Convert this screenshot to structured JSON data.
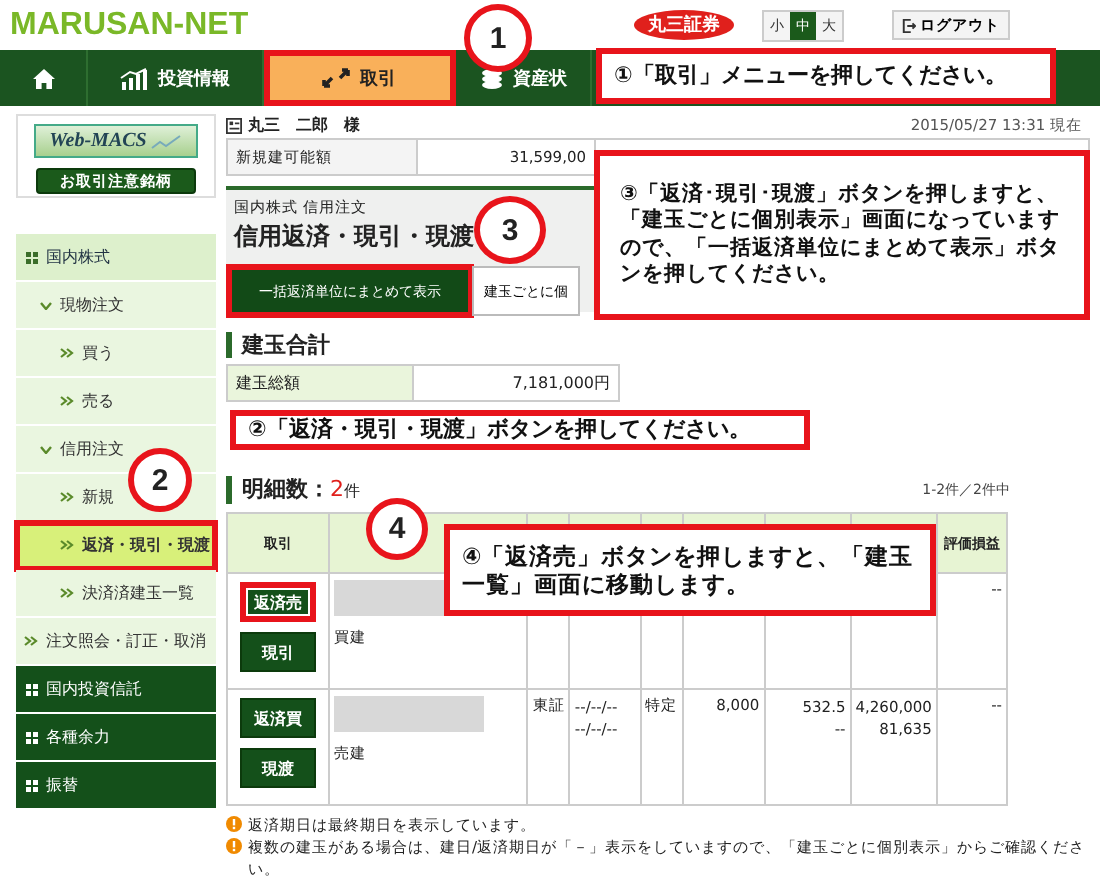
{
  "header": {
    "logo": "MARUSAN-NET",
    "brand_badge": "丸三証券",
    "font_sizes": [
      {
        "label": "小",
        "selected": false
      },
      {
        "label": "中",
        "selected": true
      },
      {
        "label": "大",
        "selected": false
      }
    ],
    "logout": "ログアウト"
  },
  "nav": [
    {
      "kind": "home",
      "selected": false
    },
    {
      "kind": "chart",
      "label": "投資情報",
      "selected": false
    },
    {
      "kind": "trade",
      "label": "取引",
      "selected": true
    },
    {
      "kind": "coins",
      "label": "資産状",
      "selected": false
    }
  ],
  "sidebar": {
    "logo": "Web-MACS",
    "notice_button": "お取引注意銘柄",
    "menu": [
      {
        "kind": "section",
        "label": "国内株式",
        "expanded": true,
        "children": [
          {
            "kind": "group",
            "label": "現物注文",
            "expanded": true,
            "children": [
              {
                "kind": "link",
                "label": "買う",
                "selected": false
              },
              {
                "kind": "link",
                "label": "売る",
                "selected": false
              }
            ]
          },
          {
            "kind": "group",
            "label": "信用注文",
            "expanded": true,
            "children": [
              {
                "kind": "link",
                "label": "新規",
                "selected": false
              },
              {
                "kind": "link",
                "label": "返済・現引・現渡",
                "selected": true
              },
              {
                "kind": "link",
                "label": "決済済建玉一覧",
                "selected": false
              }
            ]
          },
          {
            "kind": "link",
            "label": "注文照会・訂正・取消",
            "selected": false
          }
        ]
      },
      {
        "kind": "section",
        "label": "国内投資信託",
        "expanded": false
      },
      {
        "kind": "section",
        "label": "各種余力",
        "expanded": false
      },
      {
        "kind": "section",
        "label": "振替",
        "expanded": false
      }
    ]
  },
  "account": {
    "name": "丸三　二郎　様",
    "timestamp": "2015/05/27 13:31 現在",
    "field_label": "新規建可能額",
    "field_value": "31,599,00"
  },
  "panel": {
    "breadcrumb": "国内株式 信用注文",
    "title": "信用返済・現引・現渡",
    "tabs": [
      {
        "label": "一括返済単位にまとめて表示",
        "selected": true
      },
      {
        "label": "建玉ごとに個",
        "selected": false
      }
    ]
  },
  "summary": {
    "heading": "建玉合計",
    "label": "建玉総額",
    "value": "7,181,000円"
  },
  "details": {
    "heading": "明細数：",
    "count": "2",
    "count_unit": "件",
    "range": "1-2件／2件中"
  },
  "table": {
    "column_1": "取引",
    "column_9": "評価損益",
    "rows": [
      {
        "actions": [
          {
            "label": "返済売",
            "highlighted": true
          },
          {
            "label": "現引",
            "highlighted": false
          }
        ],
        "position": "買建",
        "profit_loss": "--"
      },
      {
        "actions": [
          {
            "label": "返済買",
            "highlighted": false
          },
          {
            "label": "現渡",
            "highlighted": false
          }
        ],
        "position": "売建",
        "market": "東証",
        "dates": [
          "--/--/--",
          "--/--/--"
        ],
        "account_type": "特定",
        "quantity": "8,000",
        "price": [
          "532.5",
          "--"
        ],
        "amount": [
          "4,260,000",
          "81,635"
        ],
        "profit_loss": "--"
      }
    ]
  },
  "notes": [
    "返済期日は最終期日を表示しています。",
    "複数の建玉がある場合は、建日/返済期日が「－」表示をしていますので、「建玉ごとに個別表示」からご確認ください。"
  ],
  "annotations": [
    {
      "number": "1",
      "text": "①「取引」メニューを押してください。"
    },
    {
      "number": "3",
      "text": "③「返済･現引･現渡」ボタンを押しますと、「建玉ごとに個別表示」画面になっていますので、「一括返済単位にまとめて表示」ボタンを押してください。"
    },
    {
      "number": "2",
      "text": "②「返済・現引・現渡」ボタンを押してください。"
    },
    {
      "number": "4",
      "text": "④「返済売」ボタンを押しますと、「建玉一覧」画面に移動します。"
    }
  ]
}
